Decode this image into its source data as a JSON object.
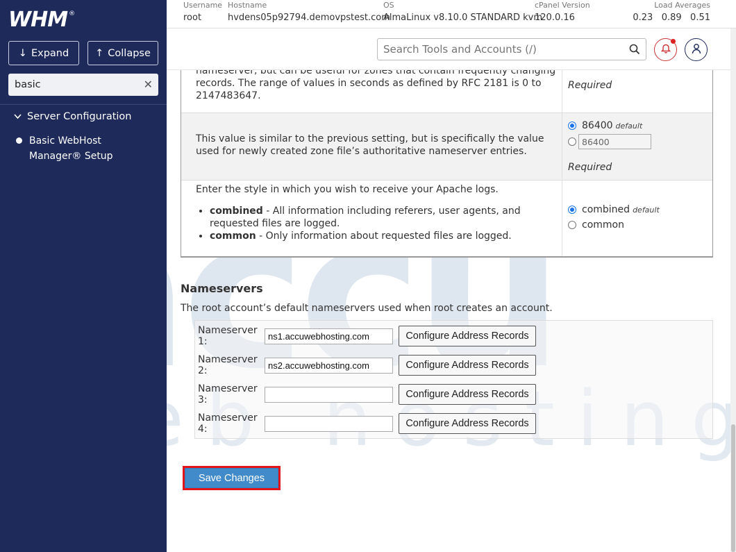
{
  "sidebar": {
    "logo_text": "WHM",
    "logo_mark": "®",
    "expand_label": "Expand",
    "collapse_label": "Collapse",
    "search_value": "basic",
    "group_label": "Server Configuration",
    "item_label": "Basic WebHost Manager® Setup"
  },
  "infobar": {
    "username_label": "Username",
    "username": "root",
    "hostname_label": "Hostname",
    "hostname": "hvdens05p92794.demovpstest.com",
    "os_label": "OS",
    "os": "AlmaLinux v8.10.0 STANDARD kvm",
    "cpanel_label": "cPanel Version",
    "cpanel": "120.0.16",
    "load_label": "Load Averages",
    "load": "0.23   0.89   0.51"
  },
  "search": {
    "placeholder": "Search Tools and Accounts (/)"
  },
  "settings": {
    "row1_desc": "nameserver, but can be useful for zones that contain frequently changing records. The range of values in seconds as defined by RFC 2181 is 0 to 2147483647.",
    "row1_required": "Required",
    "row2_desc": "This value is similar to the previous setting, but is specifically the value used for newly created zone file’s authoritative nameserver entries.",
    "row2_default_value": "86400",
    "row2_default_tag": "default",
    "row2_input_value": "86400",
    "row2_required": "Required",
    "row3_desc": "Enter the style in which you wish to receive your Apache logs.",
    "row3_b1_term": "combined",
    "row3_b1_text": " - All information including referers, user agents, and requested files are logged.",
    "row3_b2_term": "common",
    "row3_b2_text": " - Only information about requested files are logged.",
    "row3_opt1": "combined",
    "row3_opt1_tag": "default",
    "row3_opt2": "common"
  },
  "nameservers": {
    "title": "Nameservers",
    "description": "The root account’s default nameservers used when root creates an account.",
    "rows": [
      {
        "label": "Nameserver 1:",
        "value": "ns1.accuwebhosting.com",
        "button": "Configure Address Records"
      },
      {
        "label": "Nameserver 2:",
        "value": "ns2.accuwebhosting.com",
        "button": "Configure Address Records"
      },
      {
        "label": "Nameserver 3:",
        "value": "",
        "button": "Configure Address Records"
      },
      {
        "label": "Nameserver 4:",
        "value": "",
        "button": "Configure Address Records"
      }
    ]
  },
  "save_label": "Save Changes",
  "watermark": {
    "word1": "accu",
    "word2": "web hosting"
  },
  "colors": {
    "sidebar_bg": "#1e2a5a",
    "save_button": "#428bca",
    "highlight_border": "#e4141b",
    "notification": "#d22222"
  }
}
